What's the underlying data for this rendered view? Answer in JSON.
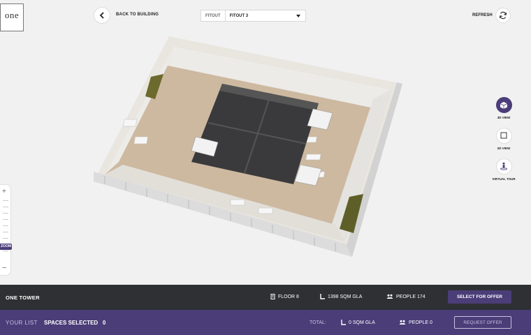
{
  "logo": {
    "word": "one",
    "tagline": ""
  },
  "header": {
    "back_label": "BACK TO BUILDING",
    "fitout_label": "FITOUT",
    "fitout_value": "FITOUT 3",
    "refresh_label": "REFRESH"
  },
  "views": [
    {
      "label": "3D VIEW",
      "icon": "cube-icon",
      "active": true
    },
    {
      "label": "2D VIEW",
      "icon": "square-icon",
      "active": false
    },
    {
      "label": "VIRTUAL TOUR",
      "icon": "person-tour-icon",
      "active": false
    }
  ],
  "zoom": {
    "badge": "ZOOM"
  },
  "info": {
    "building": "ONE TOWER",
    "floor": "FLOOR 8",
    "area": "1398 SQM GLA",
    "people": "PEOPLE 174",
    "select_button": "SELECT FOR OFFER"
  },
  "list": {
    "your_list": "YOUR LIST",
    "spaces_selected": "SPACES SELECTED",
    "spaces_count": "0",
    "total": "TOTAL:",
    "area": "0 SQM GLA",
    "people": "PEOPLE 0",
    "request_button": "REQUEST OFFER"
  },
  "colors": {
    "accent": "#4a3d78",
    "dark_bar": "#2e3033",
    "background": "#f1f1f1"
  }
}
